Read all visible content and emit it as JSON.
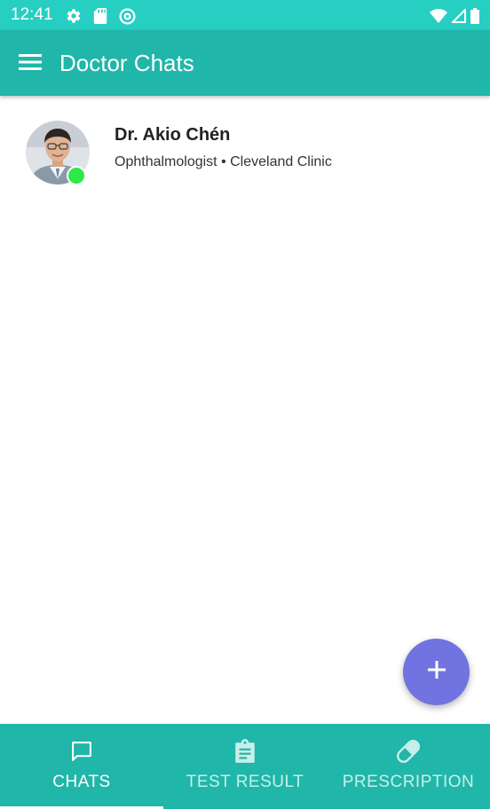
{
  "status_bar": {
    "time": "12:41",
    "left_icons": [
      "settings-icon",
      "sd-card-icon",
      "at-sign-icon"
    ],
    "right_icons": [
      "wifi-icon",
      "signal-icon",
      "battery-icon"
    ]
  },
  "app_bar": {
    "menu_icon": "hamburger-menu-icon",
    "title": "Doctor Chats"
  },
  "chats": [
    {
      "name": "Dr. Akio Chén",
      "details": "Ophthalmologist • Cleveland Clinic",
      "online": true,
      "online_color": "#2ee84a"
    }
  ],
  "fab": {
    "icon": "plus-icon",
    "color": "#7173e0"
  },
  "bottom_nav": {
    "tabs": [
      {
        "label": "CHATS",
        "icon": "chat-bubble-icon",
        "active": true
      },
      {
        "label": "TEST RESULT",
        "icon": "clipboard-icon",
        "active": false
      },
      {
        "label": "PRESCRIPTION",
        "icon": "pill-icon",
        "active": false
      }
    ]
  },
  "colors": {
    "status_bar": "#26cfc2",
    "primary": "#20b6a9",
    "text_dark": "#222222"
  }
}
